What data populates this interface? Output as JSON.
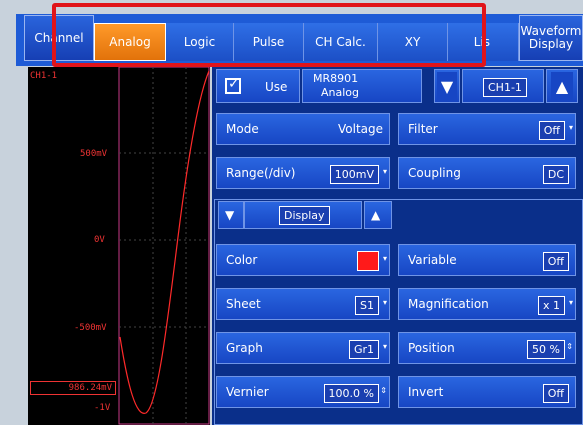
{
  "tabs": {
    "channel": "Channel",
    "analog": "Analog",
    "logic": "Logic",
    "pulse": "Pulse",
    "ch_calc": "CH Calc.",
    "xy": "XY",
    "list": "Lis",
    "waveform_display_line1": "Waveform",
    "waveform_display_line2": "Display"
  },
  "waveform": {
    "channel_label": "CH1-1",
    "tick_500": "500mV",
    "tick_0": "0V",
    "tick_m500": "-500mV",
    "tick_m1": "-1V",
    "readout": "986.24mV"
  },
  "channel_header": {
    "use_label": "Use",
    "module_line1": "MR8901",
    "module_line2": "Analog",
    "channel_id": "CH1-1"
  },
  "settings": {
    "mode_label": "Mode",
    "mode_value": "Voltage",
    "filter_label": "Filter",
    "filter_value": "Off",
    "range_label": "Range(/div)",
    "range_value": "100mV",
    "coupling_label": "Coupling",
    "coupling_value": "DC",
    "display_label": "Display",
    "color_label": "Color",
    "variable_label": "Variable",
    "variable_value": "Off",
    "sheet_label": "Sheet",
    "sheet_value": "S1",
    "magnification_label": "Magnification",
    "magnification_value": "x 1",
    "graph_label": "Graph",
    "graph_value": "Gr1",
    "position_label": "Position",
    "position_value": "50 %",
    "vernier_label": "Vernier",
    "vernier_value": "100.0 %",
    "invert_label": "Invert",
    "invert_value": "Off"
  },
  "colors": {
    "accent_orange": "#ff8a1a",
    "highlight_red": "#e0141a",
    "channel_color": "#ff1a1a"
  }
}
